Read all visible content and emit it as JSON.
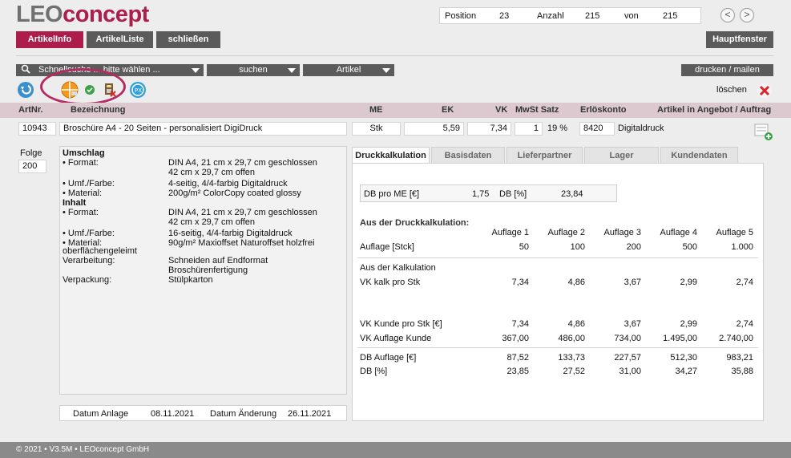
{
  "brand": {
    "part1": "LEO",
    "part2": "concept"
  },
  "position": {
    "label": "Position",
    "value": "23",
    "count_label": "Anzahl",
    "count": "215",
    "of_label": "von",
    "of_value": "215"
  },
  "nav": {
    "prev": "<",
    "next": ">"
  },
  "tabs": {
    "artikelinfo": "ArtikelInfo",
    "artikelliste": "ArtikelListe",
    "schliessen": "schließen",
    "hauptfenster": "Hauptfenster"
  },
  "toolbar": {
    "schnellsuche": "Schnellsuche ... bitte wählen ...",
    "suchen": "suchen",
    "artikel": "Artikel",
    "drucken": "drucken / mailen",
    "loeschen": "löschen"
  },
  "columns": {
    "artnr": "ArtNr.",
    "bezeichnung": "Bezeichnung",
    "me": "ME",
    "ek": "EK",
    "vk": "VK",
    "mwst": "MwSt Satz",
    "erloeskonto": "Erlöskonto",
    "angebot": "Artikel in Angebot / Auftrag"
  },
  "article": {
    "artnr": "10943",
    "bezeichnung": "Broschüre A4 - 20 Seiten - personalisiert DigiDruck",
    "me": "Stk",
    "ek": "5,59",
    "vk": "7,34",
    "mwst_code": "1",
    "mwst_pct": "19 %",
    "konto": "8420",
    "konto_name": "Digitaldruck"
  },
  "folge": {
    "label": "Folge",
    "value": "200"
  },
  "description": [
    {
      "label": "Umschlag",
      "value": "",
      "bold": true
    },
    {
      "label": "• Format:",
      "value": "DIN A4, 21 cm x 29,7 cm geschlossen"
    },
    {
      "label": "",
      "value": "42 cm x 29,7 cm offen"
    },
    {
      "label": "• Umf./Farbe:",
      "value": "4-seitig, 4/4-farbig Digitaldruck"
    },
    {
      "label": "• Material:",
      "value": "200g/m² ColorCopy coated glossy"
    },
    {
      "label": "Inhalt",
      "value": "",
      "bold": true
    },
    {
      "label": "• Format:",
      "value": "DIN A4, 21 cm x 29,7 cm geschlossen"
    },
    {
      "label": "",
      "value": "42 cm x 29,7 cm offen"
    },
    {
      "label": "• Umf./Farbe:",
      "value": "16-seitig, 4/4-farbig Digitaldruck"
    },
    {
      "label": "• Material:",
      "value": "90g/m² Maxioffset Naturoffset holzfrei"
    },
    {
      "label": "oberflächengeleimt",
      "value": ""
    },
    {
      "label": "Verarbeitung:",
      "value": "Schneiden auf Endformat"
    },
    {
      "label": "",
      "value": "Broschürenfertigung"
    },
    {
      "label": "Verpackung:",
      "value": "Stülpkarton"
    }
  ],
  "dates": {
    "anlage_label": "Datum Anlage",
    "anlage": "08.11.2021",
    "aenderung_label": "Datum Änderung",
    "aenderung": "26.11.2021"
  },
  "right_tabs": [
    "Druckkalkulation",
    "Basisdaten",
    "Lieferpartner",
    "Lager",
    "Kundendaten"
  ],
  "db": {
    "me_label": "DB pro ME [€]",
    "me_value": "1,75",
    "pct_label": "DB [%]",
    "pct_value": "23,84"
  },
  "calc": {
    "title": "Aus der Druckkalkulation:",
    "headers": [
      "Auflage 1",
      "Auflage 2",
      "Auflage 3",
      "Auflage 4",
      "Auflage 5"
    ],
    "auflage_label": "Auflage [Stck]",
    "auflage": [
      "50",
      "100",
      "200",
      "500",
      "1.000"
    ],
    "kalk_title": "Aus der Kalkulation",
    "vk_kalk_label": "VK kalk pro Stk",
    "vk_kalk": [
      "7,34",
      "4,86",
      "3,67",
      "2,99",
      "2,74"
    ],
    "vk_kunde_label": "VK Kunde pro Stk [€]",
    "vk_kunde": [
      "7,34",
      "4,86",
      "3,67",
      "2,99",
      "2,74"
    ],
    "vk_auflage_label": "VK Auflage Kunde",
    "vk_auflage": [
      "367,00",
      "486,00",
      "734,00",
      "1.495,00",
      "2.740,00"
    ],
    "db_auflage_label": "DB Auflage [€]",
    "db_auflage": [
      "87,52",
      "133,73",
      "227,57",
      "512,30",
      "983,21"
    ],
    "db_pct_label": "DB [%]",
    "db_pct": [
      "23,85",
      "27,52",
      "31,00",
      "34,27",
      "35,88"
    ]
  },
  "footer": "© 2021 • V3.5M • LEOconcept GmbH"
}
